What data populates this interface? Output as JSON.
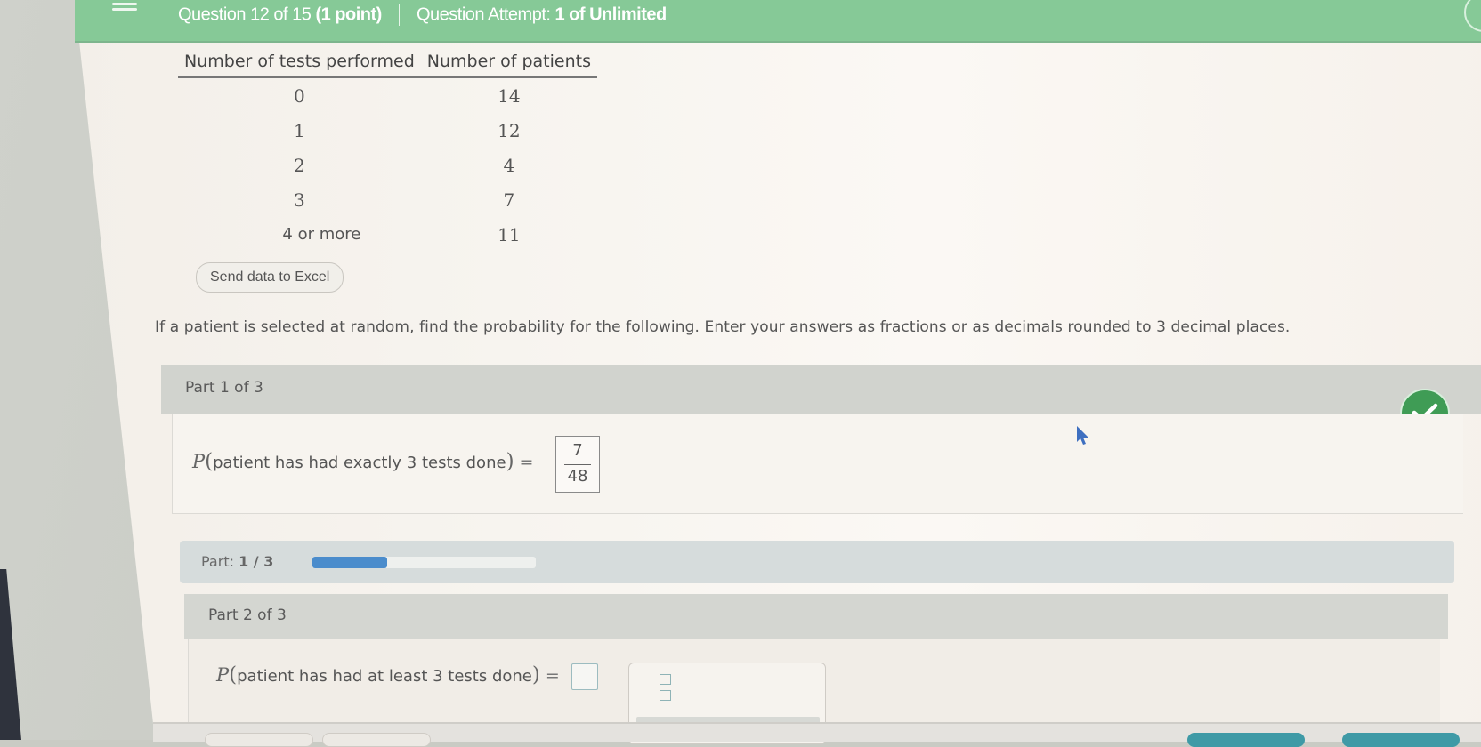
{
  "header": {
    "question_label": "Question 12 of 15",
    "points_label": "(1 point)",
    "attempt_label": "Question Attempt:",
    "attempt_value": "1 of Unlimited",
    "menu_icon": "hamburger-icon",
    "brand_color": "#86c997"
  },
  "table": {
    "headers": [
      "Number of tests performed",
      "Number of patients"
    ],
    "rows": [
      {
        "tests": "0",
        "patients": "14"
      },
      {
        "tests": "1",
        "patients": "12"
      },
      {
        "tests": "2",
        "patients": "4"
      },
      {
        "tests": "3",
        "patients": "7"
      },
      {
        "tests": "4 or more",
        "patients": "11"
      }
    ],
    "excel_button": "Send data to Excel"
  },
  "instructions": "If a patient is selected at random, find the probability for the following. Enter your answers as fractions or as decimals rounded to 3 decimal places.",
  "part1": {
    "title": "Part 1 of 3",
    "P": "P",
    "prompt": "patient has had exactly 3 tests done",
    "equals": "=",
    "answer_numerator": "7",
    "answer_denominator": "48",
    "status_icon": "check-icon",
    "status_color": "#3f9c55"
  },
  "progress": {
    "label": "Part:",
    "value": "1 / 3",
    "fraction_complete": 0.333,
    "fill_color": "#4a8ccc"
  },
  "part2": {
    "title": "Part 2 of 3",
    "P": "P",
    "prompt": "patient has had at least 3 tests done",
    "equals": "=",
    "answer_value": "",
    "keypad_icon": "fraction-template-icon"
  }
}
